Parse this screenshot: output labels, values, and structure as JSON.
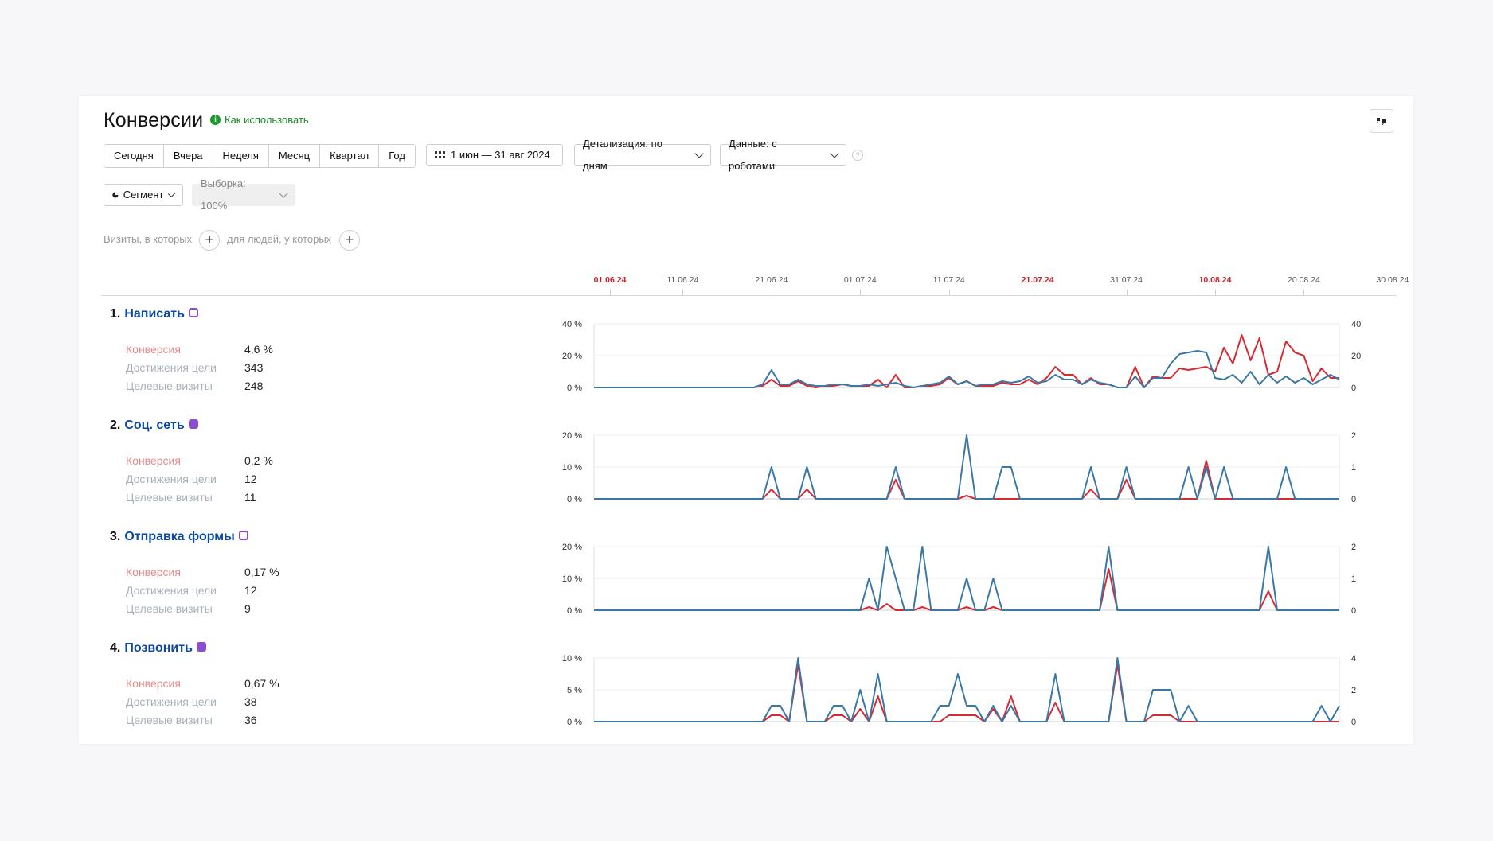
{
  "header": {
    "title": "Конверсии",
    "help_link": "Как использовать",
    "periods": [
      "Сегодня",
      "Вчера",
      "Неделя",
      "Месяц",
      "Квартал",
      "Год"
    ],
    "date_range": "1 июн — 31 авг 2024",
    "detail": "Детализация: по дням",
    "data_mode": "Данные: с роботами",
    "segment": "Сегмент",
    "sample": "Выборка: 100%",
    "visits_filter": "Визиты, в которых",
    "people_filter": "для людей, у которых"
  },
  "timeline": {
    "ticks": [
      "01.06.24",
      "11.06.24",
      "21.06.24",
      "01.07.24",
      "11.07.24",
      "21.07.24",
      "31.07.24",
      "10.08.24",
      "20.08.24",
      "30.08.24"
    ],
    "highlighted": [
      "01.06.24",
      "21.07.24",
      "10.08.24"
    ]
  },
  "metric_labels": {
    "conversion": "Конверсия",
    "goals": "Достижения цели",
    "visits": "Целевые визиты"
  },
  "goals": [
    {
      "num": "1.",
      "name": "Написать",
      "conversion": "4,6 %",
      "goals": "343",
      "visits": "248"
    },
    {
      "num": "2.",
      "name": "Соц. сеть",
      "conversion": "0,2 %",
      "goals": "12",
      "visits": "11"
    },
    {
      "num": "3.",
      "name": "Отправка формы",
      "conversion": "0,17 %",
      "goals": "12",
      "visits": "9"
    },
    {
      "num": "4.",
      "name": "Позвонить",
      "conversion": "0,67 %",
      "goals": "38",
      "visits": "36"
    }
  ],
  "colors": {
    "conversion_line": "#d62b34",
    "visits_line": "#3a78a6",
    "accent_link": "#0b48a4"
  },
  "chart_data": [
    {
      "type": "line",
      "title": "Написать",
      "y_left": [
        "40 %",
        "20 %",
        "0 %"
      ],
      "y_right": [
        "40",
        "20",
        "0"
      ],
      "ylim_left": [
        0,
        40
      ],
      "ylim_right": [
        0,
        40
      ],
      "series": [
        {
          "values": [
            0,
            0,
            0,
            0,
            0,
            0,
            0,
            0,
            0,
            0,
            0,
            0,
            0,
            0,
            0,
            0,
            0,
            0,
            0,
            1,
            5,
            1,
            1,
            4,
            1,
            0,
            1,
            1,
            2,
            1,
            1,
            1,
            5,
            0,
            8,
            0,
            0,
            1,
            1,
            2,
            6,
            2,
            4,
            1,
            1,
            1,
            3,
            2,
            2,
            5,
            2,
            6,
            13,
            8,
            8,
            2,
            6,
            2,
            2,
            0,
            0,
            13,
            0,
            7,
            6,
            6,
            12,
            11,
            12,
            13,
            10,
            25,
            15,
            33,
            17,
            31,
            8,
            10,
            29,
            22,
            20,
            4,
            12,
            6,
            6
          ]
        },
        {
          "values": [
            0,
            0,
            0,
            0,
            0,
            0,
            0,
            0,
            0,
            0,
            0,
            0,
            0,
            0,
            0,
            0,
            0,
            0,
            0,
            2,
            11,
            2,
            2,
            5,
            2,
            1,
            1,
            2,
            2,
            1,
            1,
            2,
            1,
            2,
            3,
            1,
            0,
            1,
            2,
            3,
            7,
            2,
            4,
            1,
            2,
            2,
            4,
            3,
            4,
            7,
            3,
            4,
            8,
            5,
            5,
            2,
            5,
            3,
            2,
            0,
            0,
            7,
            0,
            6,
            6,
            15,
            21,
            22,
            23,
            22,
            6,
            5,
            8,
            3,
            10,
            2,
            8,
            3,
            7,
            3,
            6,
            2,
            5,
            8,
            5
          ]
        }
      ]
    },
    {
      "type": "line",
      "title": "Соц. сеть",
      "y_left": [
        "20 %",
        "10 %",
        "0 %"
      ],
      "y_right": [
        "2",
        "1",
        "0"
      ],
      "ylim_left": [
        0,
        20
      ],
      "ylim_right": [
        0,
        2
      ],
      "series": [
        {
          "values": [
            0,
            0,
            0,
            0,
            0,
            0,
            0,
            0,
            0,
            0,
            0,
            0,
            0,
            0,
            0,
            0,
            0,
            0,
            0,
            0,
            3,
            0,
            0,
            0,
            3,
            0,
            0,
            0,
            0,
            0,
            0,
            0,
            0,
            0,
            6,
            0,
            0,
            0,
            0,
            0,
            0,
            0,
            1,
            0,
            0,
            0,
            0,
            0,
            0,
            0,
            0,
            0,
            0,
            0,
            0,
            0,
            3,
            0,
            0,
            0,
            6,
            0,
            0,
            0,
            0,
            0,
            0,
            0,
            0,
            12,
            0,
            0,
            0,
            0,
            0,
            0,
            0,
            0,
            0,
            0,
            0,
            0,
            0,
            0,
            0
          ]
        },
        {
          "values": [
            0,
            0,
            0,
            0,
            0,
            0,
            0,
            0,
            0,
            0,
            0,
            0,
            0,
            0,
            0,
            0,
            0,
            0,
            0,
            0,
            1,
            0,
            0,
            0,
            1,
            0,
            0,
            0,
            0,
            0,
            0,
            0,
            0,
            0,
            1,
            0,
            0,
            0,
            0,
            0,
            0,
            0,
            2,
            0,
            0,
            0,
            1,
            1,
            0,
            0,
            0,
            0,
            0,
            0,
            0,
            0,
            1,
            0,
            0,
            0,
            1,
            0,
            0,
            0,
            0,
            0,
            0,
            1,
            0,
            1,
            0,
            1,
            0,
            0,
            0,
            0,
            0,
            0,
            1,
            0,
            0,
            0,
            0,
            0,
            0
          ]
        }
      ]
    },
    {
      "type": "line",
      "title": "Отправка формы",
      "y_left": [
        "20 %",
        "10 %",
        "0 %"
      ],
      "y_right": [
        "2",
        "1",
        "0"
      ],
      "ylim_left": [
        0,
        20
      ],
      "ylim_right": [
        0,
        2
      ],
      "series": [
        {
          "values": [
            0,
            0,
            0,
            0,
            0,
            0,
            0,
            0,
            0,
            0,
            0,
            0,
            0,
            0,
            0,
            0,
            0,
            0,
            0,
            0,
            0,
            0,
            0,
            0,
            0,
            0,
            0,
            0,
            0,
            0,
            0,
            1,
            0,
            2,
            0,
            0,
            0,
            1,
            0,
            0,
            0,
            0,
            1,
            0,
            0,
            1,
            0,
            0,
            0,
            0,
            0,
            0,
            0,
            0,
            0,
            0,
            0,
            0,
            13,
            0,
            0,
            0,
            0,
            0,
            0,
            0,
            0,
            0,
            0,
            0,
            0,
            0,
            0,
            0,
            0,
            0,
            6,
            0,
            0,
            0,
            0,
            0,
            0,
            0,
            0
          ]
        },
        {
          "values": [
            0,
            0,
            0,
            0,
            0,
            0,
            0,
            0,
            0,
            0,
            0,
            0,
            0,
            0,
            0,
            0,
            0,
            0,
            0,
            0,
            0,
            0,
            0,
            0,
            0,
            0,
            0,
            0,
            0,
            0,
            0,
            1,
            0,
            2,
            1,
            0,
            0,
            2,
            0,
            0,
            0,
            0,
            1,
            0,
            0,
            1,
            0,
            0,
            0,
            0,
            0,
            0,
            0,
            0,
            0,
            0,
            0,
            0,
            2,
            0,
            0,
            0,
            0,
            0,
            0,
            0,
            0,
            0,
            0,
            0,
            0,
            0,
            0,
            0,
            0,
            0,
            2,
            0,
            0,
            0,
            0,
            0,
            0,
            0,
            0
          ]
        }
      ]
    },
    {
      "type": "line",
      "title": "Позвонить",
      "y_left": [
        "10 %",
        "5 %",
        "0 %"
      ],
      "y_right": [
        "4",
        "2",
        "0"
      ],
      "ylim_left": [
        0,
        10
      ],
      "ylim_right": [
        0,
        4
      ],
      "series": [
        {
          "values": [
            0,
            0,
            0,
            0,
            0,
            0,
            0,
            0,
            0,
            0,
            0,
            0,
            0,
            0,
            0,
            0,
            0,
            0,
            0,
            0,
            1,
            1,
            0,
            9,
            0,
            0,
            0,
            1,
            1,
            0,
            2,
            0,
            4,
            0,
            0,
            0,
            0,
            0,
            0,
            0,
            1,
            1,
            1,
            1,
            0,
            2,
            0,
            4,
            0,
            0,
            0,
            0,
            3,
            0,
            0,
            0,
            0,
            0,
            0,
            9,
            0,
            0,
            0,
            1,
            1,
            1,
            0,
            0,
            0,
            0,
            0,
            0,
            0,
            0,
            0,
            0,
            0,
            0,
            0,
            0,
            0,
            0,
            0,
            0,
            0
          ]
        },
        {
          "values": [
            0,
            0,
            0,
            0,
            0,
            0,
            0,
            0,
            0,
            0,
            0,
            0,
            0,
            0,
            0,
            0,
            0,
            0,
            0,
            0,
            1,
            1,
            0,
            4,
            0,
            0,
            0,
            1,
            1,
            0,
            2,
            0,
            3,
            0,
            0,
            0,
            0,
            0,
            0,
            1,
            1,
            3,
            1,
            1,
            0,
            1,
            0,
            1,
            0,
            0,
            0,
            0,
            3,
            0,
            0,
            0,
            0,
            0,
            0,
            4,
            0,
            0,
            0,
            2,
            2,
            2,
            0,
            1,
            0,
            0,
            0,
            0,
            0,
            0,
            0,
            0,
            0,
            0,
            0,
            0,
            0,
            0,
            1,
            0,
            1
          ]
        }
      ]
    }
  ]
}
